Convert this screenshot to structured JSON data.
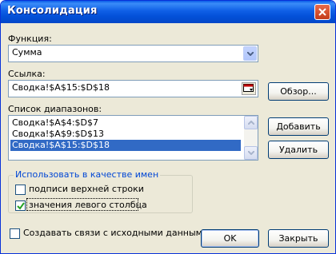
{
  "window": {
    "title": "Консолидация"
  },
  "function": {
    "label": "Функция:",
    "value": "Сумма"
  },
  "reference": {
    "label": "Ссылка:",
    "value": "Сводка!$A$15:$D$18",
    "browse_button": "Обзор..."
  },
  "ranges": {
    "label": "Список диапазонов:",
    "items": [
      "Сводка!$A$4:$D$7",
      "Сводка!$A$9:$D$13",
      "Сводка!$A$15:$D$18"
    ],
    "selected_index": 2,
    "add_button": "Добавить",
    "delete_button": "Удалить"
  },
  "use_labels": {
    "title": "Использовать в качестве имен",
    "top_row": {
      "label": "подписи верхней строки",
      "checked": false
    },
    "left_column": {
      "label": "значения левого столбца",
      "checked": true
    }
  },
  "links": {
    "label": "Создавать связи с исходными данными",
    "checked": false
  },
  "buttons": {
    "ok": "OK",
    "close": "Закрыть"
  },
  "colors": {
    "titlebar": "#0a5ce8",
    "selection": "#316ac5",
    "group_title": "#0046d5"
  }
}
